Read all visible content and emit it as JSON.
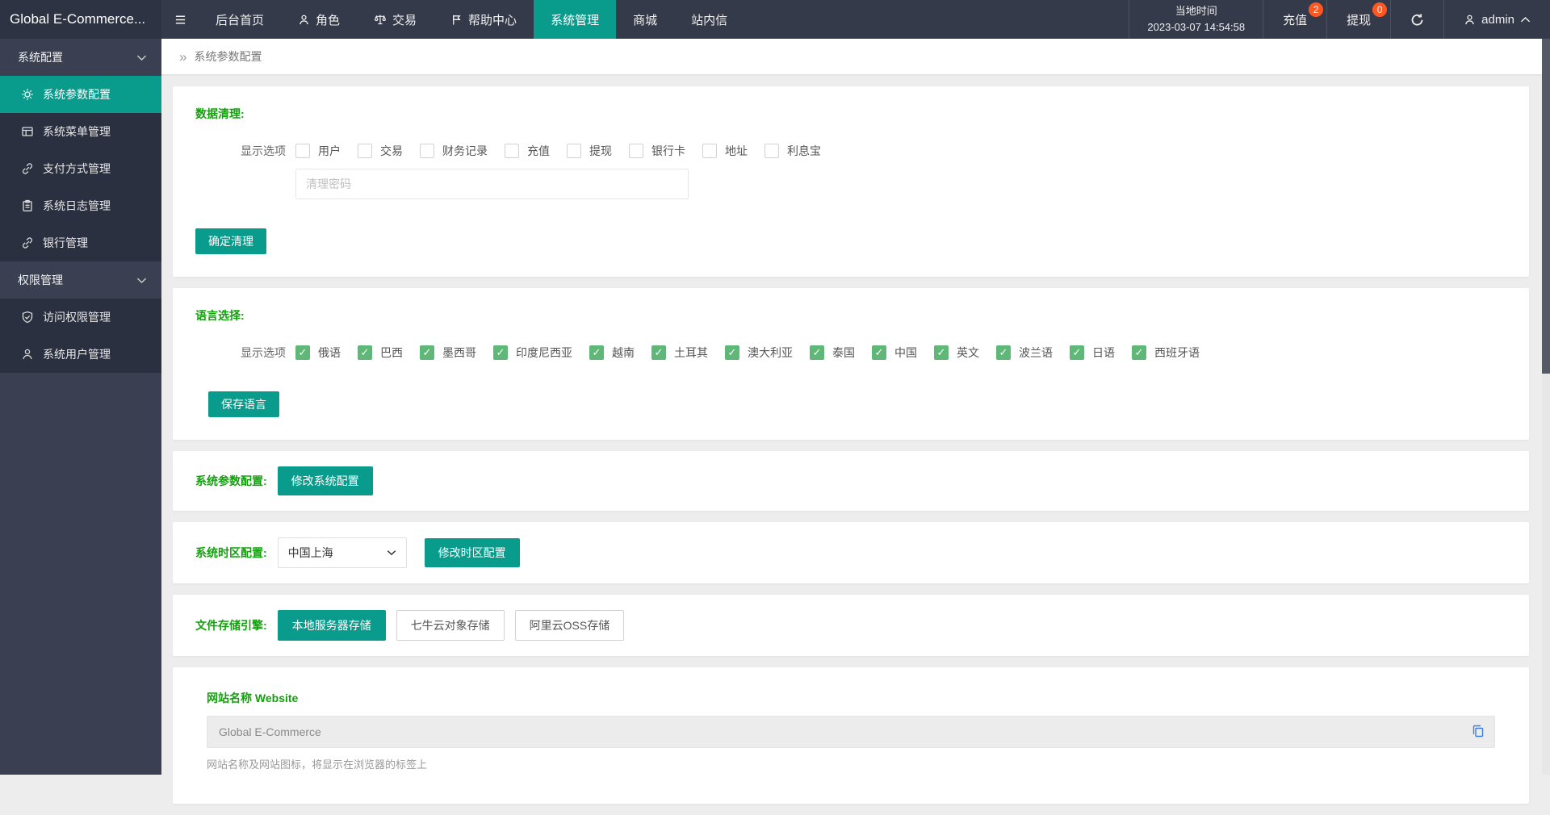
{
  "topbar": {
    "logo": "Global E-Commerce...",
    "nav": [
      {
        "label": "后台首页"
      },
      {
        "label": "角色"
      },
      {
        "label": "交易"
      },
      {
        "label": "帮助中心"
      },
      {
        "label": "系统管理"
      },
      {
        "label": "商城"
      },
      {
        "label": "站内信"
      }
    ],
    "time_label": "当地时间",
    "time_value": "2023-03-07 14:54:58",
    "recharge_label": "充值",
    "recharge_badge": "2",
    "withdraw_label": "提现",
    "withdraw_badge": "0",
    "username": "admin"
  },
  "sidebar": {
    "groups": [
      {
        "label": "系统配置",
        "items": [
          {
            "label": "系统参数配置"
          },
          {
            "label": "系统菜单管理"
          },
          {
            "label": "支付方式管理"
          },
          {
            "label": "系统日志管理"
          },
          {
            "label": "银行管理"
          }
        ]
      },
      {
        "label": "权限管理",
        "items": [
          {
            "label": "访问权限管理"
          },
          {
            "label": "系统用户管理"
          }
        ]
      }
    ]
  },
  "breadcrumb": "系统参数配置",
  "cards": {
    "data_clean": {
      "title": "数据清理:",
      "row_label": "显示选项",
      "options": [
        "用户",
        "交易",
        "财务记录",
        "充值",
        "提现",
        "银行卡",
        "地址",
        "利息宝"
      ],
      "password_placeholder": "清理密码",
      "button": "确定清理"
    },
    "language": {
      "title": "语言选择:",
      "row_label": "显示选项",
      "options": [
        "俄语",
        "巴西",
        "墨西哥",
        "印度尼西亚",
        "越南",
        "土耳其",
        "澳大利亚",
        "泰国",
        "中国",
        "英文",
        "波兰语",
        "日语",
        "西班牙语"
      ],
      "button": "保存语言"
    },
    "sys_param": {
      "label": "系统参数配置:",
      "button": "修改系统配置"
    },
    "timezone": {
      "label": "系统时区配置:",
      "selected": "中国上海",
      "button": "修改时区配置"
    },
    "storage": {
      "label": "文件存储引擎:",
      "options": [
        "本地服务器存储",
        "七牛云对象存储",
        "阿里云OSS存储"
      ],
      "active_index": 0
    },
    "site_name": {
      "label": "网站名称 Website",
      "value": "Global E-Commerce",
      "help": "网站名称及网站图标，将显示在浏览器的标签上"
    }
  },
  "colors": {
    "accent_teal": "#099c8c",
    "label_green": "#12a10c",
    "checkbox_green": "#5FB878",
    "badge_orange": "#FF5722",
    "topbar_dark": "#343a49"
  }
}
